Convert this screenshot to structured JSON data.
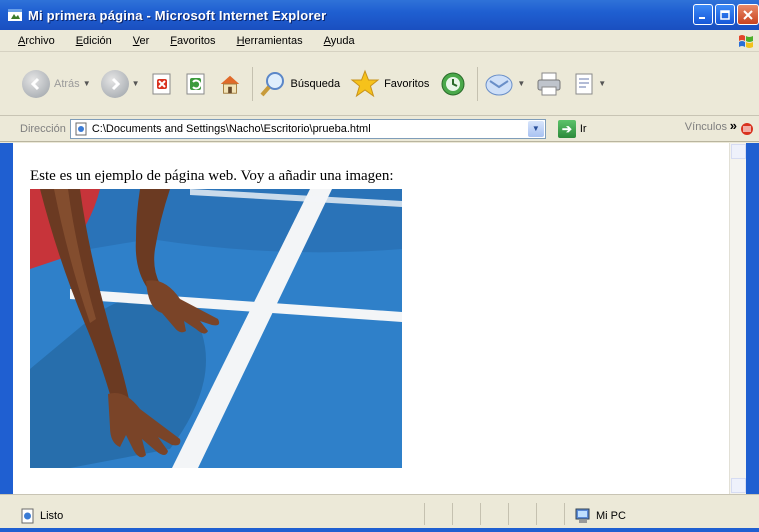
{
  "window": {
    "title": "Mi primera página - Microsoft Internet Explorer"
  },
  "menu": {
    "items": [
      "Archivo",
      "Edición",
      "Ver",
      "Favoritos",
      "Herramientas",
      "Ayuda"
    ]
  },
  "toolbar": {
    "back_label": "Atrás",
    "search_label": "Búsqueda",
    "favorites_label": "Favoritos"
  },
  "address": {
    "label": "Dirección",
    "url": "C:\\Documents and Settings\\Nacho\\Escritorio\\prueba.html",
    "go_label": "Ir",
    "links_label": "Vínculos"
  },
  "page": {
    "text": "Este es un ejemplo de página web. Voy a añadir una imagen:"
  },
  "status": {
    "left": "Listo",
    "zone": "Mi PC"
  },
  "colors": {
    "titlebar": "#1f5fd1",
    "track_blue": "#2b7bc6",
    "lane_white": "#f3f5f7"
  }
}
